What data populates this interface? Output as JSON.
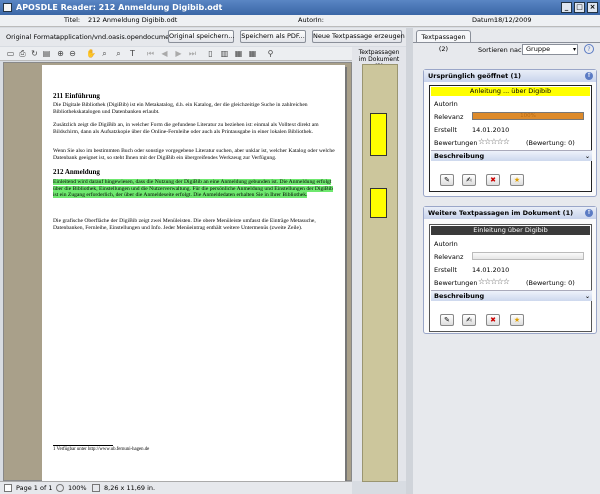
{
  "window": {
    "title": "APOSDLE Reader: 212 Anmeldung Digibib.odt"
  },
  "meta": {
    "title_label": "Titel:",
    "title_value": "212 Anmeldung Digibib.odt",
    "author_label": "AutorIn:",
    "date_label": "Datum:",
    "date_value": "18/12/2009"
  },
  "format_bar": {
    "label": "Original Format:",
    "value": "application/vnd.oasis.opendocument.text",
    "btn_original": "Original speichern...",
    "btn_pdf": "Speichern als PDF...",
    "btn_new": "Neue Textpassage erzeugen"
  },
  "mid": {
    "header": "Textpassagen im Dokument (2)"
  },
  "document": {
    "h1": "211 Einführung",
    "p1": "Die Digitale Bibliothek (DigiBib) ist ein Metakatalog, d.h. ein Katalog, der die gleichzeitige Suche in zahlreichen Bibliothekskatalogen und Datenbanken erlaubt.",
    "p2": "Zusätzlich zeigt die DigiBib an, in welcher Form die gefundene Literatur zu beziehen ist: einmal als Volltext direkt am Bildschirm, dann als Aufsatzkopie über die Online-Fernleihe oder auch als Printausgabe in einer lokalen Bibliothek.",
    "p3": "Wenn Sie also im bestimmten Buch oder sonstige vorgegebene Literatur suchen, aber unklar ist, welcher Katalog oder welche Datenbank geeignet ist, so steht Ihnen mit der DigiBib ein übergreifendes Werkzeug zur Verfügung.",
    "h2": "212 Anmeldung",
    "p4": "Einleitend wird darauf hingewiesen, dass die Nutzung der DigiBib an eine Anmeldung gebunden ist. Die Anmeldung erfolgt über die Bibliothek, Einstellungen und die Nutzerverwaltung. Für die persönliche Anmeldung und Einstellungen der DigiBib ist ein Zugang erforderlich, der über die Anmeldeseite erfolgt. Die Anmeldedaten erhalten Sie in Ihrer Bibliothek.",
    "p5": "Die grafische Oberfläche der DigiBib zeigt zwei Menüleisten. Die obere Menüleiste umfasst die Einträge Metasuche, Datenbanken, Fernleihe, Einstellungen und Info. Jeder Menüeintrag enthält weitere Untermenüs (zweite Zeile).",
    "footnote": "1 Verfügbar unter http://www.ub.fernuni-hagen.de"
  },
  "status": {
    "page": "Page 1 of 1",
    "zoom": "100%",
    "size": "8,26 x 11,69 in."
  },
  "right": {
    "tab": "Textpassagen (2)",
    "sort_label": "Sortieren nach",
    "sort_value": "Gruppe",
    "panel1": {
      "title": "Ursprünglich geöffnet (1)",
      "card_title": "Anleitung ... über Digibib",
      "author_label": "AutorIn",
      "relevance_label": "Relevanz",
      "relevance_text": "100%",
      "relevance": 1.0,
      "created_label": "Erstellt",
      "created_value": "14.01.2010",
      "ratings_label": "Bewertungen",
      "ratings_value": "(Bewertung: 0)",
      "stars": "☆☆☆☆☆",
      "desc_label": "Beschreibung"
    },
    "panel2": {
      "title": "Weitere Textpassagen im Dokument (1)",
      "card_title": "Einleitung über Digibib",
      "author_label": "AutorIn",
      "relevance_label": "Relevanz",
      "relevance": 0.0,
      "created_label": "Erstellt",
      "created_value": "14.01.2010",
      "ratings_label": "Bewertungen",
      "ratings_value": "(Bewertung: 0)",
      "stars": "☆☆☆☆☆",
      "desc_label": "Beschreibung"
    }
  },
  "colors": {
    "highlight": "#6ee86e",
    "marker": "#ffff00",
    "selected_card": "#ffff00"
  }
}
